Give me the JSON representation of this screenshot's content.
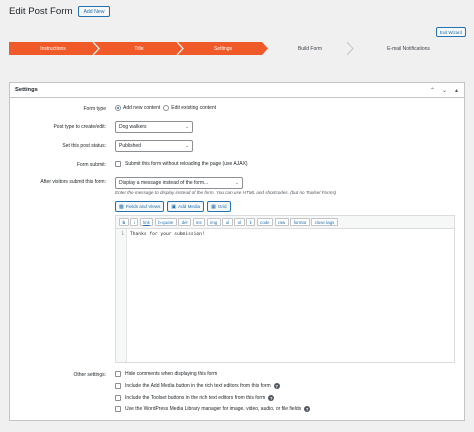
{
  "header": {
    "title": "Edit Post Form",
    "add_new": "Add New",
    "exit_wizard": "Exit Wizard"
  },
  "wizard": {
    "steps": [
      {
        "label": "Instructions",
        "state": "done"
      },
      {
        "label": "Title",
        "state": "done"
      },
      {
        "label": "Settings",
        "state": "current"
      },
      {
        "label": "Build Form",
        "state": "pending"
      },
      {
        "label": "E-mail Notifications",
        "state": "pending"
      }
    ],
    "colors": {
      "active": "#f05a28",
      "inactive": "#f0f0f1",
      "divider": "#ffffff"
    }
  },
  "panel": {
    "title": "Settings"
  },
  "form_type": {
    "label": "Form type",
    "option_add": "Add new content",
    "option_edit": "Edit existing content",
    "selected": "add"
  },
  "post_type": {
    "label": "Post type to create/edit:",
    "value": "Dog walkers"
  },
  "post_status": {
    "label": "Set this post status:",
    "value": "Published"
  },
  "form_submit": {
    "label": "Form submit:",
    "option": "Submit this form without reloading the page (use AJAX)"
  },
  "after_submit": {
    "label": "After visitors submit this form:",
    "value": "Display a message instead of the form...",
    "help": "Enter the message to display instead of the form. You can use HTML and shortcodes. (but no Toolset Forms)"
  },
  "editor": {
    "buttons": {
      "fields_views": "Fields and Views",
      "add_media": "Add Media",
      "grid": "Grid"
    },
    "quicktags": [
      "b",
      "i",
      "link",
      "b-quote",
      "del",
      "ins",
      "img",
      "ul",
      "ol",
      "li",
      "code",
      "raw",
      "format",
      "close tags"
    ],
    "line_number": "1",
    "content": "Thanks for your submission!"
  },
  "other_settings": {
    "label": "Other settings:",
    "options": [
      {
        "text": "Hide comments when displaying this form",
        "help": false
      },
      {
        "text": "Include the Add Media button in the rich text editors from this form",
        "help": true
      },
      {
        "text": "Include the Toolset buttons in the rich text editors from this form",
        "help": true
      },
      {
        "text": "Use the WordPress Media Library manager for image, video, audio, or file fields",
        "help": true
      }
    ]
  }
}
